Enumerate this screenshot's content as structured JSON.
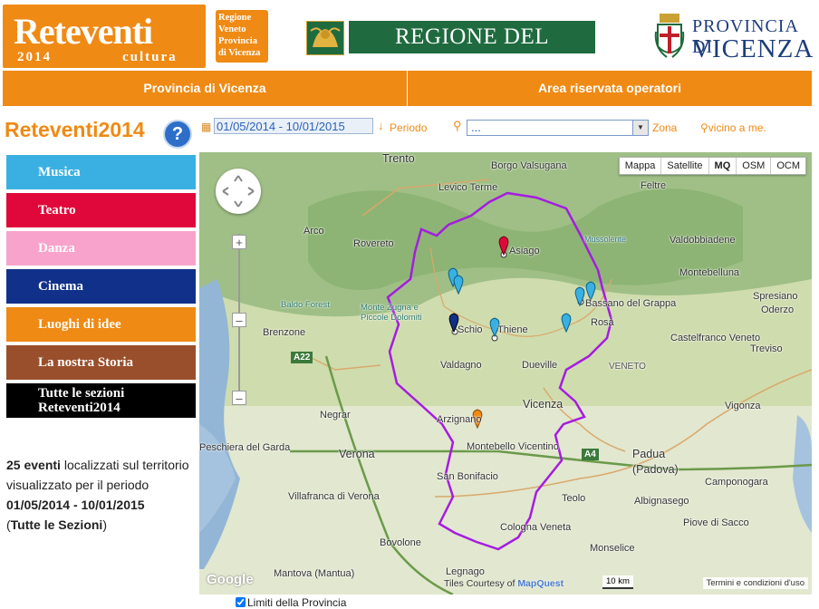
{
  "header": {
    "logo": {
      "title": "Reteventi",
      "year": "2014",
      "subtitle": "cultura"
    },
    "regione_box": [
      "Regione",
      "Veneto",
      "Provincia",
      "di Vicenza"
    ],
    "regione_banner": "REGIONE DEL VENETO",
    "provincia_line1": "PROVINCIA DI",
    "provincia_line2": "VICENZA"
  },
  "nav": {
    "provincia": "Provincia di Vicenza",
    "area_riservata": "Area riservata operatori"
  },
  "sidebar": {
    "brand": "Reteventi2014",
    "help": "?",
    "categories": [
      {
        "label": "Musica",
        "color": "#3ab0e2"
      },
      {
        "label": "Teatro",
        "color": "#e0083a"
      },
      {
        "label": "Danza",
        "color": "#f8a3cc"
      },
      {
        "label": "Cinema",
        "color": "#10308a"
      },
      {
        "label": "Luoghi di idee",
        "color": "#ef8a14"
      },
      {
        "label": "La nostra Storia",
        "color": "#9a4f2c"
      },
      {
        "label": "Tutte le sezioni Reteventi2014",
        "color": "#000000"
      }
    ],
    "summary": {
      "count": "25 eventi",
      "text1": " localizzati sul territorio visualizzato per il periodo ",
      "period": "01/05/2014 - 10/01/2015",
      "open": "(",
      "sections": "Tutte le Sezioni",
      "close": ")"
    }
  },
  "filters": {
    "date_value": "01/05/2014 - 10/01/2015",
    "periodo": "Periodo",
    "zone_value": "...",
    "zona": "Zona",
    "vicino": "vicino a me."
  },
  "map": {
    "types": [
      "Mappa",
      "Satellite",
      "MQ",
      "OSM",
      "OCM"
    ],
    "active_type": "MQ",
    "places": [
      "Trento",
      "Borgo Valsugana",
      "Levico Terme",
      "Feltre",
      "Arco",
      "Rovereto",
      "Asiago",
      "Mussolente",
      "Valdobbiadene",
      "Baldo Forest",
      "Monte Zugna e Piccole Dolomiti",
      "Brenzone",
      "Schio",
      "Thiene",
      "Bassano del Grappa",
      "Rosà",
      "Valdagno",
      "Dueville",
      "VENETO",
      "Vicenza",
      "Arzignano",
      "Negrar",
      "Montebello Vicentino",
      "San Bonifacio",
      "Padua (Padova)",
      "Verona",
      "Villafranca di Verona",
      "Teolo",
      "Albignasego",
      "Bovolone",
      "Legnago",
      "Monselice",
      "Piove di Sacco",
      "Camponogara",
      "Vigonza",
      "Treviso",
      "Montebelluna",
      "Oderzo",
      "Spresiano",
      "Mantova (Mantua)",
      "Peschiera del Garda",
      "Castelfranco Veneto",
      "Cologna Veneta"
    ],
    "highways": [
      "A22",
      "A4"
    ],
    "tiles_prefix": "Tiles Courtesy of ",
    "tiles_brand": "MapQuest",
    "scale": "10 km",
    "terms": "Termini e condizioni d'uso",
    "google": "Google",
    "limiti": "Limiti della Provincia",
    "markers": [
      {
        "place": "Asiago",
        "category": "Teatro",
        "color": "#e0083a"
      },
      {
        "place": "Schio",
        "category": "Musica",
        "color": "#3ab0e2"
      },
      {
        "place": "Schio",
        "category": "Musica",
        "color": "#3ab0e2"
      },
      {
        "place": "Schio",
        "category": "Cinema",
        "color": "#10308a"
      },
      {
        "place": "Thiene",
        "category": "Musica",
        "color": "#3ab0e2"
      },
      {
        "place": "Bassano del Grappa",
        "category": "Musica",
        "color": "#3ab0e2"
      },
      {
        "place": "Bassano del Grappa",
        "category": "Musica",
        "color": "#3ab0e2"
      },
      {
        "place": "Rosà",
        "category": "Musica",
        "color": "#3ab0e2"
      },
      {
        "place": "Arzignano",
        "category": "Luoghi di idee",
        "color": "#ef8a14"
      }
    ]
  }
}
